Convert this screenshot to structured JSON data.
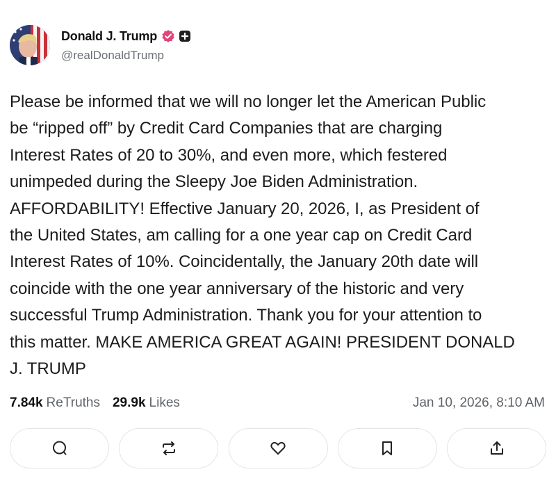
{
  "author": {
    "display_name": "Donald J. Trump",
    "handle": "@realDonaldTrump",
    "verified_icon": "verified-badge-icon",
    "plus_icon": "plus-badge-icon"
  },
  "post": {
    "text": "Please be informed that we will no longer let the American Public\nbe “ripped off” by Credit Card Companies that are charging\nInterest Rates of 20 to 30%, and even more, which festered\nunimpeded during the Sleepy Joe Biden Administration.\nAFFORDABILITY! Effective January 20, 2026, I, as President of\nthe United States, am calling for a one year cap on Credit Card\nInterest Rates of 10%. Coincidentally, the January 20th date will\ncoincide with the one year anniversary of the historic and very\nsuccessful Trump Administration. Thank you for your attention to\nthis matter. MAKE AMERICA GREAT AGAIN! PRESIDENT DONALD\nJ. TRUMP"
  },
  "stats": {
    "retruths_count": "7.84k",
    "retruths_label": "ReTruths",
    "likes_count": "29.9k",
    "likes_label": "Likes",
    "timestamp": "Jan 10, 2026, 8:10 AM"
  },
  "actions": [
    {
      "icon": "reply-icon"
    },
    {
      "icon": "retruth-icon"
    },
    {
      "icon": "like-heart-icon"
    },
    {
      "icon": "bookmark-icon"
    },
    {
      "icon": "share-icon"
    }
  ],
  "colors": {
    "verified_badge": "#e0457a",
    "text": "#1c1c1c",
    "muted": "#5f6368",
    "border": "#e3e5e8"
  }
}
